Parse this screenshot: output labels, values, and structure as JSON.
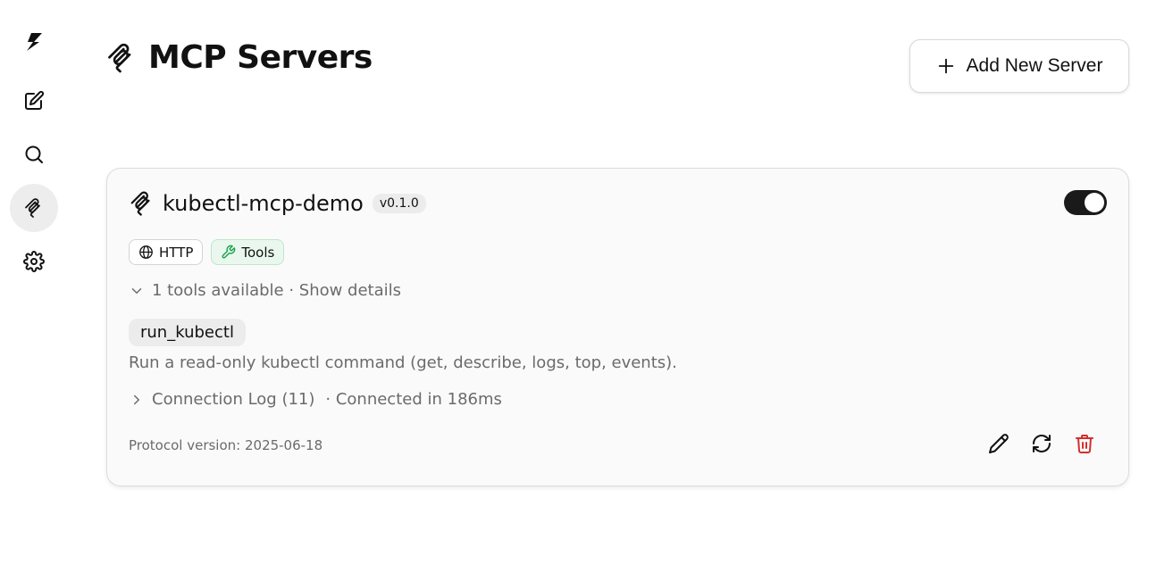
{
  "page": {
    "title": "MCP Servers",
    "add_button_label": "Add New Server"
  },
  "sidebar": {
    "items": [
      {
        "name": "logo",
        "icon": "bolt-logo-icon"
      },
      {
        "name": "new-chat",
        "icon": "edit-icon"
      },
      {
        "name": "search",
        "icon": "search-icon"
      },
      {
        "name": "mcp-servers",
        "icon": "mcp-icon",
        "active": true
      },
      {
        "name": "settings",
        "icon": "gear-icon"
      }
    ]
  },
  "server": {
    "name": "kubectl-mcp-demo",
    "version": "v0.1.0",
    "enabled": true,
    "badges": {
      "transport": "HTTP",
      "capability": "Tools"
    },
    "tools_summary": "1 tools available · Show details",
    "tool": {
      "name": "run_kubectl",
      "description": "Run a read-only kubectl command (get, describe, logs, top, events)."
    },
    "connection_log": "Connection Log (11)",
    "connection_time": "· Connected in 186ms",
    "protocol_version": "Protocol version: 2025-06-18"
  },
  "colors": {
    "accent": "#111111",
    "delete": "#d32f2f",
    "tools_badge_bg": "#eaf7ee",
    "tools_icon": "#16a34a",
    "muted_text": "#6b6b6b"
  }
}
